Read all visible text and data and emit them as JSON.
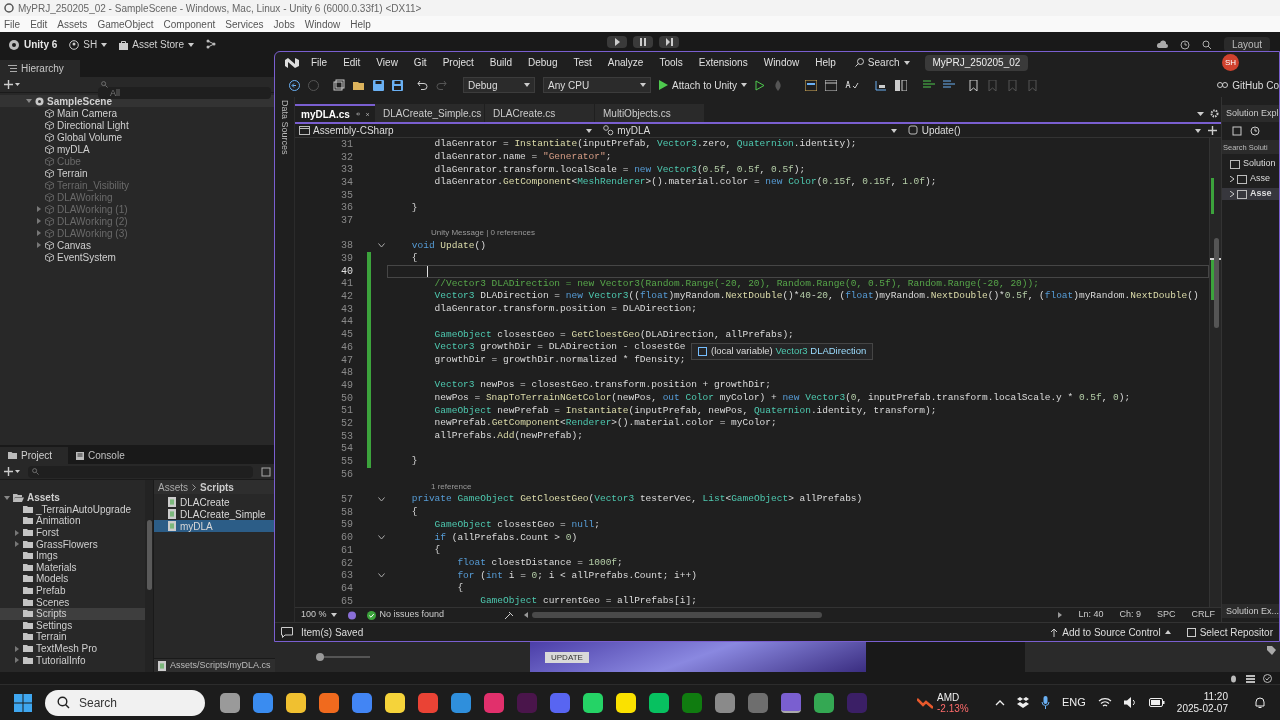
{
  "unity": {
    "title": "MyPRJ_250205_02 - SampleScene - Windows, Mac, Linux - Unity 6 (6000.0.33f1) <DX11>",
    "menu": [
      "File",
      "Edit",
      "Assets",
      "GameObject",
      "Component",
      "Services",
      "Jobs",
      "Window",
      "Help"
    ],
    "toolbar": {
      "brand": "Unity 6",
      "account": "SH",
      "asset_store": "Asset Store",
      "layout": "Layout"
    },
    "hierarchy": {
      "tab": "Hierarchy",
      "search": {
        "placeholder": "All"
      },
      "tree": [
        {
          "label": "SampleScene",
          "has_children": true,
          "expanded": true,
          "disabled": false,
          "children": [
            {
              "label": "Main Camera",
              "has_children": false,
              "disabled": false
            },
            {
              "label": "Directional Light",
              "has_children": false,
              "disabled": false
            },
            {
              "label": "Global Volume",
              "has_children": false,
              "disabled": false
            },
            {
              "label": "myDLA",
              "has_children": false,
              "disabled": false
            },
            {
              "label": "Cube",
              "has_children": false,
              "disabled": true
            },
            {
              "label": "Terrain",
              "has_children": false,
              "disabled": false
            },
            {
              "label": "Terrain_Visibility",
              "has_children": false,
              "disabled": true
            },
            {
              "label": "DLAWorking",
              "has_children": false,
              "disabled": true
            },
            {
              "label": "DLAWorking (1)",
              "has_children": true,
              "expanded": false,
              "disabled": true
            },
            {
              "label": "DLAWorking (2)",
              "has_children": true,
              "expanded": false,
              "disabled": true
            },
            {
              "label": "DLAWorking (3)",
              "has_children": true,
              "expanded": false,
              "disabled": true
            },
            {
              "label": "Canvas",
              "has_children": true,
              "expanded": false,
              "disabled": false
            },
            {
              "label": "EventSystem",
              "has_children": false,
              "disabled": false
            }
          ]
        }
      ]
    },
    "project": {
      "tabs": [
        {
          "label": "Project",
          "selected": true
        },
        {
          "label": "Console",
          "selected": false
        }
      ],
      "folders": [
        {
          "label": "Assets",
          "has_children": true,
          "expanded": true,
          "selected": false,
          "children": [
            {
              "label": "_TerrainAutoUpgrade",
              "has_children": false,
              "selected": false
            },
            {
              "label": "Animation",
              "has_children": false,
              "selected": false
            },
            {
              "label": "Forst",
              "has_children": true,
              "expanded": false,
              "selected": false
            },
            {
              "label": "GrassFlowers",
              "has_children": true,
              "expanded": false,
              "selected": false
            },
            {
              "label": "Imgs",
              "has_children": false,
              "selected": false
            },
            {
              "label": "Materials",
              "has_children": false,
              "selected": false
            },
            {
              "label": "Models",
              "has_children": false,
              "selected": false
            },
            {
              "label": "Prefab",
              "has_children": false,
              "selected": false
            },
            {
              "label": "Scenes",
              "has_children": false,
              "selected": false
            },
            {
              "label": "Scripts",
              "has_children": false,
              "selected": true
            },
            {
              "label": "Settings",
              "has_children": false,
              "selected": false
            },
            {
              "label": "Terrain",
              "has_children": false,
              "selected": false
            },
            {
              "label": "TextMesh Pro",
              "has_children": true,
              "expanded": false,
              "selected": false
            },
            {
              "label": "TutorialInfo",
              "has_children": true,
              "expanded": false,
              "selected": false
            }
          ]
        }
      ],
      "breadcrumb": [
        "Assets",
        "Scripts"
      ],
      "files": [
        {
          "label": "DLACreate",
          "selected": false
        },
        {
          "label": "DLACreate_Simple",
          "selected": false
        },
        {
          "label": "myDLA",
          "selected": true
        }
      ],
      "path": "Assets/Scripts/myDLA.cs",
      "zoom_slider": {
        "level": 0
      }
    },
    "scene": {
      "button": "UPDATE"
    }
  },
  "visual_studio": {
    "menu": [
      "File",
      "Edit",
      "View",
      "Git",
      "Project",
      "Build",
      "Debug",
      "Test",
      "Analyze",
      "Tools",
      "Extensions",
      "Window",
      "Help"
    ],
    "search": "Search",
    "title": "MyPRJ_250205_02",
    "avatar": "SH",
    "toolbar": {
      "configuration": "Debug",
      "platform": "Any CPU",
      "start": "Attach to Unity",
      "github": "GitHub Co"
    },
    "side_tab": "Data Sources",
    "tabs": [
      {
        "label": "myDLA.cs",
        "selected": true
      },
      {
        "label": "DLACreate_Simple.cs",
        "selected": false
      },
      {
        "label": "DLACreate.cs",
        "selected": false
      },
      {
        "label": "MultiObjects.cs",
        "selected": false
      }
    ],
    "navigation": [
      "Assembly-CSharp",
      "myDLA",
      "Update()"
    ],
    "lines": [
      {
        "kind": "code",
        "number": "31",
        "fold": false,
        "changed": false,
        "current": false,
        "tokens": [
          {
            "kind": "plain",
            "text": "        dlaGenrator = "
          },
          {
            "kind": "method",
            "text": "Instantiate"
          },
          {
            "kind": "plain",
            "text": "(inputPrefab, "
          },
          {
            "kind": "type",
            "text": "Vector3"
          },
          {
            "kind": "plain",
            "text": ".zero, "
          },
          {
            "kind": "type",
            "text": "Quaternion"
          },
          {
            "kind": "plain",
            "text": ".identity);"
          }
        ]
      },
      {
        "kind": "code",
        "number": "32",
        "fold": false,
        "changed": false,
        "current": false,
        "tokens": [
          {
            "kind": "plain",
            "text": "        dlaGenrator.name = "
          },
          {
            "kind": "string",
            "text": "\"Generator\""
          },
          {
            "kind": "plain",
            "text": ";"
          }
        ]
      },
      {
        "kind": "code",
        "number": "33",
        "fold": false,
        "changed": false,
        "current": false,
        "tokens": [
          {
            "kind": "plain",
            "text": "        dlaGenrator.transform.localScale = "
          },
          {
            "kind": "keyword",
            "text": "new "
          },
          {
            "kind": "type",
            "text": "Vector3"
          },
          {
            "kind": "plain",
            "text": "("
          },
          {
            "kind": "number",
            "text": "0.5f"
          },
          {
            "kind": "plain",
            "text": ", "
          },
          {
            "kind": "number",
            "text": "0.5f"
          },
          {
            "kind": "plain",
            "text": ", "
          },
          {
            "kind": "number",
            "text": "0.5f"
          },
          {
            "kind": "plain",
            "text": ");"
          }
        ]
      },
      {
        "kind": "code",
        "number": "34",
        "fold": false,
        "changed": false,
        "current": false,
        "tokens": [
          {
            "kind": "plain",
            "text": "        dlaGenrator."
          },
          {
            "kind": "method",
            "text": "GetComponent"
          },
          {
            "kind": "plain",
            "text": "<"
          },
          {
            "kind": "type",
            "text": "MeshRenderer"
          },
          {
            "kind": "plain",
            "text": ">().material.color = "
          },
          {
            "kind": "keyword",
            "text": "new "
          },
          {
            "kind": "type",
            "text": "Color"
          },
          {
            "kind": "plain",
            "text": "("
          },
          {
            "kind": "number",
            "text": "0.15f"
          },
          {
            "kind": "plain",
            "text": ", "
          },
          {
            "kind": "number",
            "text": "0.15f"
          },
          {
            "kind": "plain",
            "text": ", "
          },
          {
            "kind": "number",
            "text": "1.0f"
          },
          {
            "kind": "plain",
            "text": ");"
          }
        ]
      },
      {
        "kind": "code",
        "number": "35",
        "fold": false,
        "changed": false,
        "current": false
      },
      {
        "kind": "code",
        "number": "36",
        "fold": false,
        "changed": false,
        "current": false,
        "tokens": [
          {
            "kind": "plain",
            "text": "    }"
          }
        ]
      },
      {
        "kind": "code",
        "number": "37",
        "fold": false,
        "changed": false,
        "current": false
      },
      {
        "kind": "lens",
        "text": "Unity Message | 0 references"
      },
      {
        "kind": "code",
        "number": "38",
        "fold": true,
        "changed": false,
        "current": false,
        "tokens": [
          {
            "kind": "keyword",
            "text": "    void "
          },
          {
            "kind": "method",
            "text": "Update"
          },
          {
            "kind": "plain",
            "text": "()"
          }
        ]
      },
      {
        "kind": "code",
        "number": "39",
        "fold": false,
        "changed": true,
        "current": false,
        "tokens": [
          {
            "kind": "plain",
            "text": "    {"
          }
        ]
      },
      {
        "kind": "code",
        "number": "40",
        "fold": false,
        "changed": true,
        "current": true
      },
      {
        "kind": "code",
        "number": "41",
        "fold": false,
        "changed": true,
        "current": false,
        "tokens": [
          {
            "kind": "comment",
            "text": "        //Vector3 DLADirection = new Vector3(Random.Range(-20, 20), Random.Range(0, 0.5f), Random.Range(-20, 20));"
          }
        ]
      },
      {
        "kind": "code",
        "number": "42",
        "fold": false,
        "changed": true,
        "current": false,
        "tokens": [
          {
            "kind": "type",
            "text": "        Vector3"
          },
          {
            "kind": "plain",
            "text": " DLADirection = "
          },
          {
            "kind": "keyword",
            "text": "new "
          },
          {
            "kind": "type",
            "text": "Vector3"
          },
          {
            "kind": "plain",
            "text": "(("
          },
          {
            "kind": "keyword",
            "text": "float"
          },
          {
            "kind": "plain",
            "text": ")myRandom."
          },
          {
            "kind": "method",
            "text": "NextDouble"
          },
          {
            "kind": "plain",
            "text": "()*"
          },
          {
            "kind": "number",
            "text": "40"
          },
          {
            "kind": "plain",
            "text": "-"
          },
          {
            "kind": "number",
            "text": "20"
          },
          {
            "kind": "plain",
            "text": ", ("
          },
          {
            "kind": "keyword",
            "text": "float"
          },
          {
            "kind": "plain",
            "text": ")myRandom."
          },
          {
            "kind": "method",
            "text": "NextDouble"
          },
          {
            "kind": "plain",
            "text": "()*"
          },
          {
            "kind": "number",
            "text": "0.5f"
          },
          {
            "kind": "plain",
            "text": ", ("
          },
          {
            "kind": "keyword",
            "text": "float"
          },
          {
            "kind": "plain",
            "text": ")myRandom."
          },
          {
            "kind": "method",
            "text": "NextDouble"
          },
          {
            "kind": "plain",
            "text": "()"
          }
        ]
      },
      {
        "kind": "code",
        "number": "43",
        "fold": false,
        "changed": true,
        "current": false,
        "tokens": [
          {
            "kind": "plain",
            "text": "        dlaGenrator.transform.position = DLADirection;"
          }
        ]
      },
      {
        "kind": "code",
        "number": "44",
        "fold": false,
        "changed": true,
        "current": false
      },
      {
        "kind": "code",
        "number": "45",
        "fold": false,
        "changed": true,
        "current": false,
        "tokens": [
          {
            "kind": "type",
            "text": "        GameObject"
          },
          {
            "kind": "plain",
            "text": " closestGeo = "
          },
          {
            "kind": "method",
            "text": "GetCloestGeo"
          },
          {
            "kind": "plain",
            "text": "(DLADirection, allPrefabs);"
          }
        ]
      },
      {
        "kind": "code",
        "number": "46",
        "fold": false,
        "changed": true,
        "current": false,
        "tokens": [
          {
            "kind": "type",
            "text": "        Vector3"
          },
          {
            "kind": "plain",
            "text": " growthDir = DLADirection - closestGe"
          }
        ]
      },
      {
        "kind": "code",
        "number": "47",
        "fold": false,
        "changed": true,
        "current": false,
        "tokens": [
          {
            "kind": "plain",
            "text": "        growthDir = growthDir.normalized * fDensity;"
          }
        ]
      },
      {
        "kind": "code",
        "number": "48",
        "fold": false,
        "changed": true,
        "current": false
      },
      {
        "kind": "code",
        "number": "49",
        "fold": false,
        "changed": true,
        "current": false,
        "tokens": [
          {
            "kind": "type",
            "text": "        Vector3"
          },
          {
            "kind": "plain",
            "text": " newPos = closestGeo.transform.position + growthDir;"
          }
        ]
      },
      {
        "kind": "code",
        "number": "50",
        "fold": false,
        "changed": true,
        "current": false,
        "tokens": [
          {
            "kind": "plain",
            "text": "        newPos = "
          },
          {
            "kind": "method",
            "text": "SnapToTerrainNGetColor"
          },
          {
            "kind": "plain",
            "text": "(newPos, "
          },
          {
            "kind": "keyword",
            "text": "out "
          },
          {
            "kind": "type",
            "text": "Color"
          },
          {
            "kind": "plain",
            "text": " myColor) + "
          },
          {
            "kind": "keyword",
            "text": "new "
          },
          {
            "kind": "type",
            "text": "Vector3"
          },
          {
            "kind": "plain",
            "text": "("
          },
          {
            "kind": "number",
            "text": "0"
          },
          {
            "kind": "plain",
            "text": ", inputPrefab.transform.localScale.y * "
          },
          {
            "kind": "number",
            "text": "0.5f"
          },
          {
            "kind": "plain",
            "text": ", "
          },
          {
            "kind": "number",
            "text": "0"
          },
          {
            "kind": "plain",
            "text": ");"
          }
        ]
      },
      {
        "kind": "code",
        "number": "51",
        "fold": false,
        "changed": true,
        "current": false,
        "tokens": [
          {
            "kind": "type",
            "text": "        GameObject"
          },
          {
            "kind": "plain",
            "text": " newPrefab = "
          },
          {
            "kind": "method",
            "text": "Instantiate"
          },
          {
            "kind": "plain",
            "text": "(inputPrefab, newPos, "
          },
          {
            "kind": "type",
            "text": "Quaternion"
          },
          {
            "kind": "plain",
            "text": ".identity, transform);"
          }
        ]
      },
      {
        "kind": "code",
        "number": "52",
        "fold": false,
        "changed": true,
        "current": false,
        "tokens": [
          {
            "kind": "plain",
            "text": "        newPrefab."
          },
          {
            "kind": "method",
            "text": "GetComponent"
          },
          {
            "kind": "plain",
            "text": "<"
          },
          {
            "kind": "type",
            "text": "Renderer"
          },
          {
            "kind": "plain",
            "text": ">().material.color = myColor;"
          }
        ]
      },
      {
        "kind": "code",
        "number": "53",
        "fold": false,
        "changed": true,
        "current": false,
        "tokens": [
          {
            "kind": "plain",
            "text": "        allPrefabs."
          },
          {
            "kind": "method",
            "text": "Add"
          },
          {
            "kind": "plain",
            "text": "(newPrefab);"
          }
        ]
      },
      {
        "kind": "code",
        "number": "54",
        "fold": false,
        "changed": true,
        "current": false
      },
      {
        "kind": "code",
        "number": "55",
        "fold": false,
        "changed": true,
        "current": false,
        "tokens": [
          {
            "kind": "plain",
            "text": "    }"
          }
        ]
      },
      {
        "kind": "code",
        "number": "56",
        "fold": false,
        "changed": false,
        "current": false
      },
      {
        "kind": "lens",
        "text": "1 reference"
      },
      {
        "kind": "code",
        "number": "57",
        "fold": true,
        "changed": false,
        "current": false,
        "tokens": [
          {
            "kind": "keyword",
            "text": "    private "
          },
          {
            "kind": "type",
            "text": "GameObject "
          },
          {
            "kind": "method",
            "text": "GetCloestGeo"
          },
          {
            "kind": "plain",
            "text": "("
          },
          {
            "kind": "type",
            "text": "Vector3"
          },
          {
            "kind": "plain",
            "text": " testerVec, "
          },
          {
            "kind": "type",
            "text": "List"
          },
          {
            "kind": "plain",
            "text": "<"
          },
          {
            "kind": "type",
            "text": "GameObject"
          },
          {
            "kind": "plain",
            "text": "> allPrefabs)"
          }
        ]
      },
      {
        "kind": "code",
        "number": "58",
        "fold": false,
        "changed": false,
        "current": false,
        "tokens": [
          {
            "kind": "plain",
            "text": "    {"
          }
        ]
      },
      {
        "kind": "code",
        "number": "59",
        "fold": false,
        "changed": false,
        "current": false,
        "tokens": [
          {
            "kind": "type",
            "text": "        GameObject"
          },
          {
            "kind": "plain",
            "text": " closestGeo = "
          },
          {
            "kind": "keyword",
            "text": "null"
          },
          {
            "kind": "plain",
            "text": ";"
          }
        ]
      },
      {
        "kind": "code",
        "number": "60",
        "fold": true,
        "changed": false,
        "current": false,
        "tokens": [
          {
            "kind": "keyword",
            "text": "        if"
          },
          {
            "kind": "plain",
            "text": " (allPrefabs.Count > "
          },
          {
            "kind": "number",
            "text": "0"
          },
          {
            "kind": "plain",
            "text": ")"
          }
        ]
      },
      {
        "kind": "code",
        "number": "61",
        "fold": false,
        "changed": false,
        "current": false,
        "tokens": [
          {
            "kind": "plain",
            "text": "        {"
          }
        ]
      },
      {
        "kind": "code",
        "number": "62",
        "fold": false,
        "changed": false,
        "current": false,
        "tokens": [
          {
            "kind": "keyword",
            "text": "            float"
          },
          {
            "kind": "plain",
            "text": " cloestDistance = "
          },
          {
            "kind": "number",
            "text": "1000f"
          },
          {
            "kind": "plain",
            "text": ";"
          }
        ]
      },
      {
        "kind": "code",
        "number": "63",
        "fold": true,
        "changed": false,
        "current": false,
        "tokens": [
          {
            "kind": "keyword",
            "text": "            for"
          },
          {
            "kind": "plain",
            "text": " ("
          },
          {
            "kind": "keyword",
            "text": "int"
          },
          {
            "kind": "plain",
            "text": " i = "
          },
          {
            "kind": "number",
            "text": "0"
          },
          {
            "kind": "plain",
            "text": "; i < allPrefabs.Count; i++)"
          }
        ]
      },
      {
        "kind": "code",
        "number": "64",
        "fold": false,
        "changed": false,
        "current": false,
        "tokens": [
          {
            "kind": "plain",
            "text": "            {"
          }
        ]
      },
      {
        "kind": "code",
        "number": "65",
        "fold": false,
        "changed": false,
        "current": false,
        "tokens": [
          {
            "kind": "type",
            "text": "                GameObject"
          },
          {
            "kind": "plain",
            "text": " currentGeo = allPrefabs[i];"
          }
        ]
      }
    ],
    "tooltip": [
      {
        "kind": "plain",
        "text": "(local variable)"
      },
      {
        "kind": "type",
        "text": "Vector3"
      },
      {
        "kind": "variable",
        "text": "DLADirection"
      }
    ],
    "editor_status": {
      "zoom": "100 %",
      "issues": "No issues found",
      "line": "Ln: 40",
      "column": "Ch: 9",
      "whitespace": "SPC",
      "line_ending": "CRLF"
    },
    "solution_explorer": {
      "title": "Solution Expl",
      "search": {
        "placeholder": "Search Soluti"
      },
      "items": [
        {
          "label": "Solution",
          "selected": false
        },
        {
          "label": "Asse",
          "selected": false
        },
        {
          "label": "Asse",
          "selected": true
        }
      ],
      "footer_tab": "Solution Ex..."
    },
    "status_bar": {
      "message": "Item(s) Saved",
      "source_control": "Add to Source Control",
      "repository": "Select Repositor"
    }
  },
  "taskbar": {
    "search": {
      "placeholder": "Search"
    },
    "stock": {
      "label": "AMD",
      "change": "-2.13%"
    },
    "language": "ENG",
    "time": "11:20",
    "date": "2025-02-07"
  }
}
